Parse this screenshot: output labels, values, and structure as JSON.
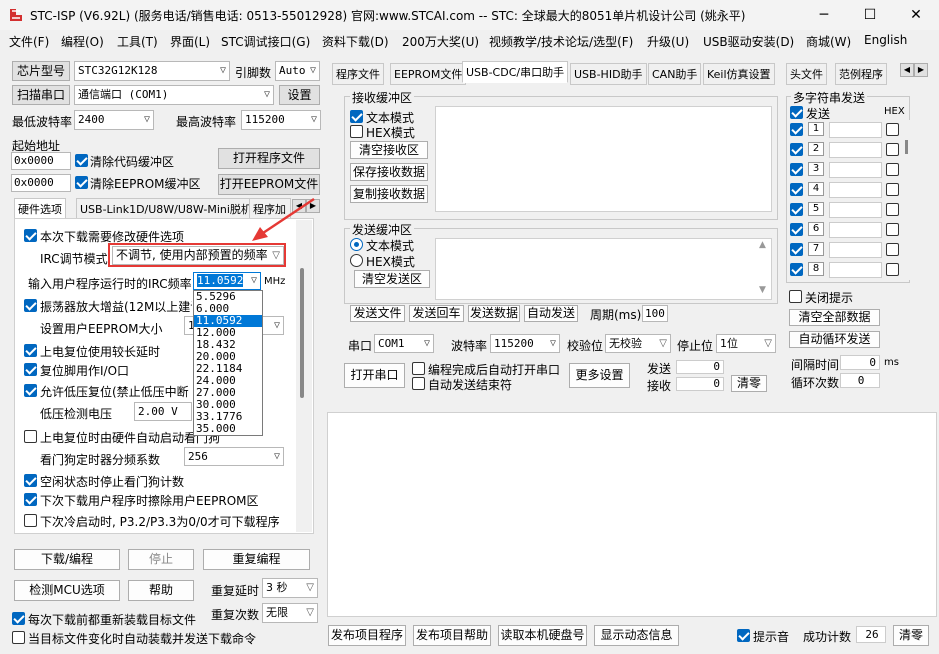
{
  "window": {
    "title": "STC-ISP (V6.92L) (服务电话/销售电话: 0513-55012928) 官网:www.STCAI.com  -- STC: 全球最大的8051单片机设计公司 (姚永平)",
    "minimize": "─",
    "maximize": "☐",
    "close": "✕"
  },
  "menu": [
    "文件(F)",
    "编程(O)",
    "工具(T)",
    "界面(L)",
    "STC调试接口(G)",
    "资料下载(D)",
    "200万大奖(U)",
    "视频教学/技术论坛/选型(F)",
    "升级(U)",
    "USB驱动安装(D)",
    "商城(W)",
    "English"
  ],
  "left": {
    "chip_label": "芯片型号",
    "chip_value": "STC32G12K128",
    "pins_label": "引脚数",
    "pins_value": "Auto",
    "scan_port": "扫描串口",
    "port_value": "通信端口 (COM1)",
    "settings": "设置",
    "min_baud_label": "最低波特率",
    "min_baud_value": "2400",
    "max_baud_label": "最高波特率",
    "max_baud_value": "115200",
    "start_addr_label": "起始地址",
    "addr1": "0x0000",
    "clear_code": "清除代码缓冲区",
    "open_prog": "打开程序文件",
    "addr2": "0x0000",
    "clear_eeprom": "清除EEPROM缓冲区",
    "open_eeprom": "打开EEPROM文件",
    "tabs": [
      "硬件选项",
      "USB-Link1D/U8W/U8W-Mini脱机",
      "程序加"
    ],
    "options": {
      "modify_hw": "本次下载需要修改硬件选项",
      "irc_mode_label": "IRC调节模式",
      "irc_mode_value": "不调节, 使用内部预置的频率",
      "irc_freq_label": "输入用户程序运行时的IRC频率",
      "irc_freq_value": "11.0592",
      "irc_unit": "MHz",
      "osc_gain": "振荡器放大增益(12M以上建议",
      "eeprom_size_label": "设置用户EEPROM大小",
      "eeprom_size_value": "1",
      "por_delay": "上电复位使用较长延时",
      "reset_io": "复位脚用作I/O口",
      "lvd_reset": "允许低压复位(禁止低压中断",
      "lvd_voltage_label": "低压检测电压",
      "lvd_voltage_value": "2.00 V",
      "wdt_hw": "上电复位时由硬件自动启动看门狗",
      "wdt_div_label": "看门狗定时器分频系数",
      "wdt_div_value": "256",
      "idle_wdt": "空闲状态时停止看门狗计数",
      "erase_eeprom": "下次下载用户程序时擦除用户EEPROM区",
      "cold_start": "下次冷启动时, P3.2/P3.3为0/0才可下载程序"
    },
    "freq_options": [
      "5.5296",
      "6.000",
      "11.0592",
      "12.000",
      "18.432",
      "20.000",
      "22.1184",
      "24.000",
      "27.000",
      "30.000",
      "33.1776",
      "35.000"
    ],
    "download": "下载/编程",
    "stop": "停止",
    "reprogram": "重复编程",
    "detect_mcu": "检测MCU选项",
    "help": "帮助",
    "repeat_delay_label": "重复延时",
    "repeat_delay_value": "3 秒",
    "repeat_count_label": "重复次数",
    "repeat_count_value": "无限",
    "reload_each": "每次下载前都重新装载目标文件",
    "auto_send_on_change": "当目标文件变化时自动装载并发送下载命令"
  },
  "right": {
    "tabs": [
      "程序文件",
      "EEPROM文件",
      "USB-CDC/串口助手",
      "USB-HID助手",
      "CAN助手",
      "Keil仿真设置",
      "头文件",
      "范例程序"
    ],
    "recv_group": "接收缓冲区",
    "recv_text_mode": "文本模式",
    "recv_hex_mode": "HEX模式",
    "clear_recv": "清空接收区",
    "save_recv": "保存接收数据",
    "copy_recv": "复制接收数据",
    "send_group": "发送缓冲区",
    "send_text_mode": "文本模式",
    "send_hex_mode": "HEX模式",
    "clear_send": "清空发送区",
    "send_file": "发送文件",
    "send_return": "发送回车",
    "send_data": "发送数据",
    "auto_send": "自动发送",
    "period_label": "周期(ms)",
    "period_value": "100",
    "multi_group": "多字符串发送",
    "send_col": "发送",
    "hex_col": "HEX",
    "rows": [
      "1",
      "2",
      "3",
      "4",
      "5",
      "6",
      "7",
      "8"
    ],
    "close_prompt": "关闭提示",
    "clear_all": "清空全部数据",
    "auto_loop": "自动循环发送",
    "interval_label": "间隔时间",
    "interval_value": "0",
    "interval_unit": "ms",
    "loop_count_label": "循环次数",
    "loop_count_value": "0",
    "port_label": "串口",
    "port_value": "COM1",
    "baud_label": "波特率",
    "baud_value": "115200",
    "parity_label": "校验位",
    "parity_value": "无校验",
    "stop_label": "停止位",
    "stop_value": "1位",
    "open_port": "打开串口",
    "auto_open": "编程完成后自动打开串口",
    "auto_end": "自动发送结束符",
    "more_settings": "更多设置",
    "send_count_label": "发送",
    "send_count_value": "0",
    "recv_count_label": "接收",
    "recv_count_value": "0",
    "clear_count": "清零"
  },
  "bottom": {
    "publish_prog": "发布项目程序",
    "publish_help": "发布项目帮助",
    "read_disk": "读取本机硬盘号",
    "show_info": "显示动态信息",
    "beep": "提示音",
    "success_label": "成功计数",
    "success_value": "26",
    "clear": "清零"
  }
}
